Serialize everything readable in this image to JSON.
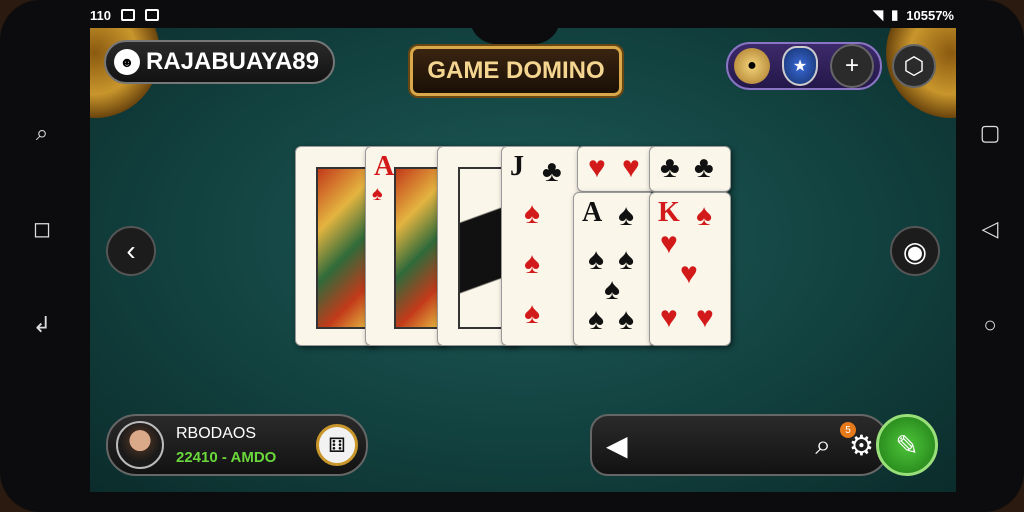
{
  "status_bar": {
    "time": "110",
    "battery": "10557%"
  },
  "header": {
    "player_name": "RAJABUAYA89",
    "game_title": "GAME DOMINO"
  },
  "cards": [
    {
      "rank": "",
      "suit": "",
      "color": "face"
    },
    {
      "rank": "A",
      "suit": "♠",
      "color": "red"
    },
    {
      "rank": "",
      "suit": "",
      "color": "face"
    },
    {
      "rank": "J",
      "suit": "♣",
      "color": "blk"
    },
    {
      "rank": "A",
      "suit": "♠",
      "color": "blk"
    },
    {
      "rank": "K",
      "suit": "♠",
      "color": "red"
    }
  ],
  "player_panel": {
    "name": "RBODAOS",
    "coins": "22410 - AMDO"
  },
  "icons": {
    "back": "chevron-left",
    "settings": "gear",
    "add": "plus",
    "home": "hexagon",
    "go": "edit"
  }
}
